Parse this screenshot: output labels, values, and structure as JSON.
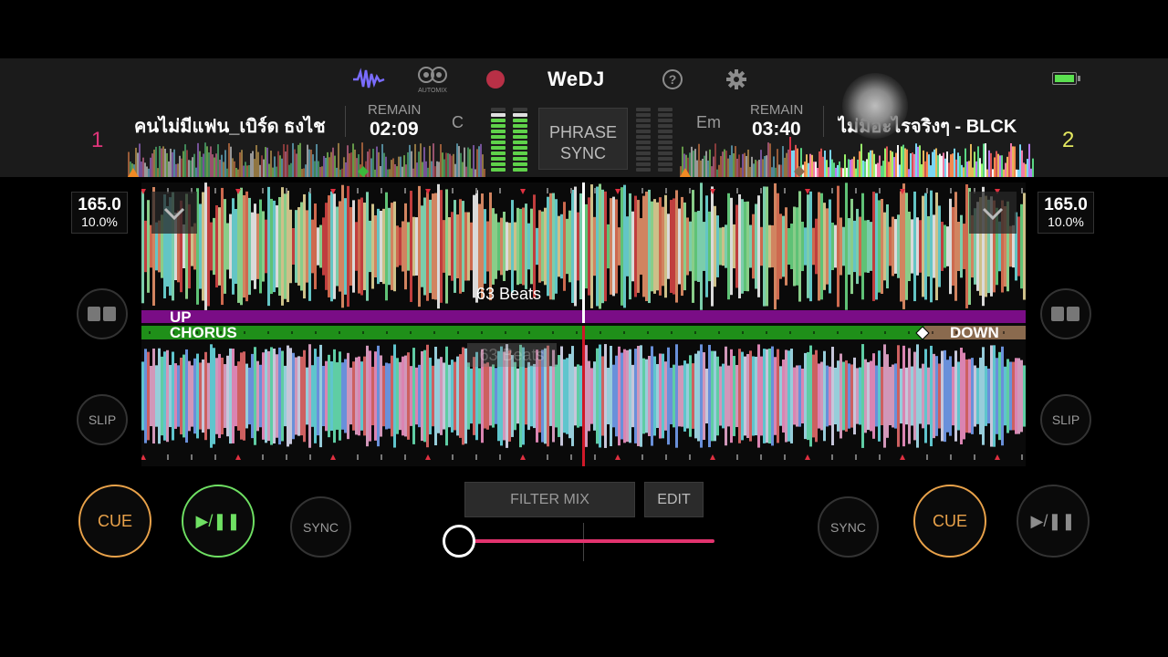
{
  "header": {
    "app_name": "WeDJ",
    "automix_label": "AUTOMIX",
    "colors": {
      "accent": "#7a6cff",
      "record": "#d9364f",
      "battery": "#5be050"
    }
  },
  "deck1": {
    "number": "1",
    "number_color": "#e0357a",
    "title": "คนไม่มีแฟน_เบิร์ด ธงไช",
    "remain_label": "REMAIN",
    "remain": "02:09",
    "key": "C",
    "bpm": "165.0",
    "pitch": "10.0%",
    "cue_label": "CUE",
    "play_label": "▶/❚❚",
    "sync_label": "SYNC",
    "slip_label": "SLIP"
  },
  "deck2": {
    "number": "2",
    "number_color": "#e3e860",
    "title": "ไม่มีอะไรจริงๆ - BLCK",
    "remain_label": "REMAIN",
    "remain": "03:40",
    "key": "Em",
    "bpm": "165.0",
    "pitch": "10.0%",
    "cue_label": "CUE",
    "play_label": "▶/❚❚",
    "sync_label": "SYNC",
    "slip_label": "SLIP"
  },
  "center": {
    "phrase_sync_line1": "PHRASE",
    "phrase_sync_line2": "SYNC",
    "filter_mix_label": "FILTER MIX",
    "edit_label": "EDIT",
    "crossfader_position": 0.0
  },
  "waveform": {
    "beats_label": "63 Beats",
    "ghost_beats_label": "63 Beats",
    "phrase_up": "UP",
    "phrase_chorus": "CHORUS",
    "phrase_down": "DOWN",
    "up_color": "#7a0d86",
    "chorus_color": "#1f8f19",
    "down_color": "#8a6a4e"
  }
}
